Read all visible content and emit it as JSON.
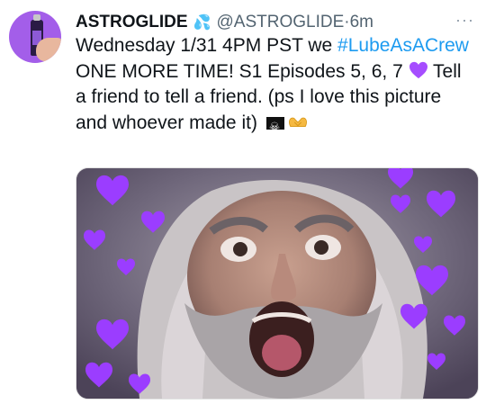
{
  "tweet": {
    "display_name": "ASTROGLIDE",
    "verified_icon": "water-drops-icon",
    "handle": "@ASTROGLIDE",
    "separator": "·",
    "time": "6m",
    "more_icon": "more-options-icon",
    "more_label": "···",
    "text": {
      "part1": "Wednesday 1/31 4PM PST we ",
      "hashtag": "#LubeAsACrew",
      "part2": " ONE MORE TIME! S1 Episodes 5, 6, 7 ",
      "part3": " Tell a friend to tell a friend. (ps I love this picture and whoever made it) "
    },
    "emoji": [
      "purple-heart-icon",
      "pirate-flag-icon",
      "heart-hands-icon"
    ],
    "media_description_icon": "shouting-bearded-man-photo"
  },
  "colors": {
    "link": "#1d9bf0",
    "text": "#0f1419",
    "muted": "#536471",
    "heart": "#a64dff"
  }
}
